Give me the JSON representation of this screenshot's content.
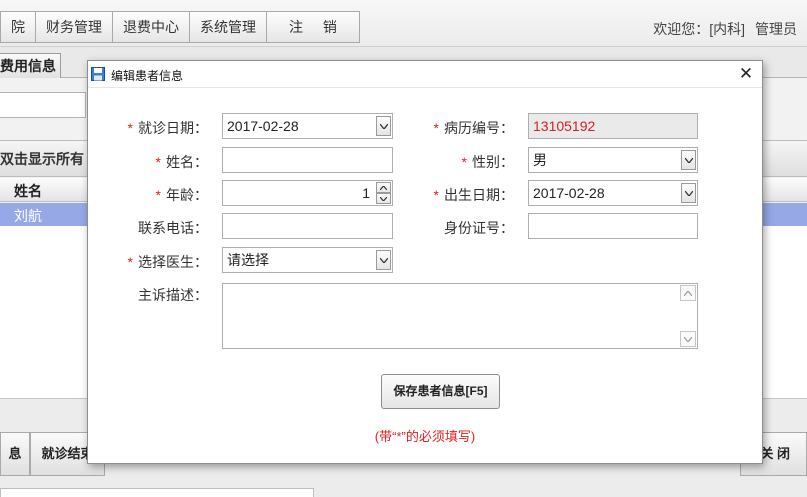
{
  "app": {
    "menu": [
      {
        "label": "院"
      },
      {
        "label": "财务管理"
      },
      {
        "label": "退费中心"
      },
      {
        "label": "系统管理"
      },
      {
        "label": "注  销"
      }
    ],
    "welcome": "欢迎您：[内科]",
    "user_role": "管理员"
  },
  "background": {
    "tab_label": "费用信息",
    "grid_title": "双击显示所有",
    "grid_header": {
      "col1": "姓名"
    },
    "selected_row": {
      "name": "刘航"
    },
    "bottom_buttons": {
      "info": "息",
      "finish": "就诊结束",
      "close": "关 闭"
    }
  },
  "dialog": {
    "title": "编辑患者信息",
    "close_glyph": "✕",
    "fields": {
      "visit_date": {
        "label": "就诊日期：",
        "value": "2017-02-28",
        "required": true
      },
      "record_no": {
        "label": "病历编号：",
        "value": "13105192",
        "required": true
      },
      "name": {
        "label": "姓名：",
        "value": "",
        "required": true
      },
      "gender": {
        "label": "性别：",
        "value": "男",
        "required": true
      },
      "age": {
        "label": "年龄：",
        "value": "1",
        "required": true
      },
      "birth_date": {
        "label": "出生日期：",
        "value": "2017-02-28",
        "required": true
      },
      "phone": {
        "label": "联系电话：",
        "value": ""
      },
      "id_card": {
        "label": "身份证号：",
        "value": ""
      },
      "doctor": {
        "label": "选择医生：",
        "value": "请选择",
        "required": true
      },
      "complaint": {
        "label": "主诉描述：",
        "value": ""
      }
    },
    "required_mark": "*",
    "save_button": "保存患者信息[F5]",
    "hint": "(带“*”的必须填写)"
  },
  "colors": {
    "required": "#e02020",
    "selected_row": "#97a8e6",
    "readonly_text": "#d02222"
  },
  "icons": {
    "dialog_icon": "floppy-disk-icon",
    "dropdown": "chevron-down-icon",
    "spinner": "spinner-arrows-icon"
  }
}
